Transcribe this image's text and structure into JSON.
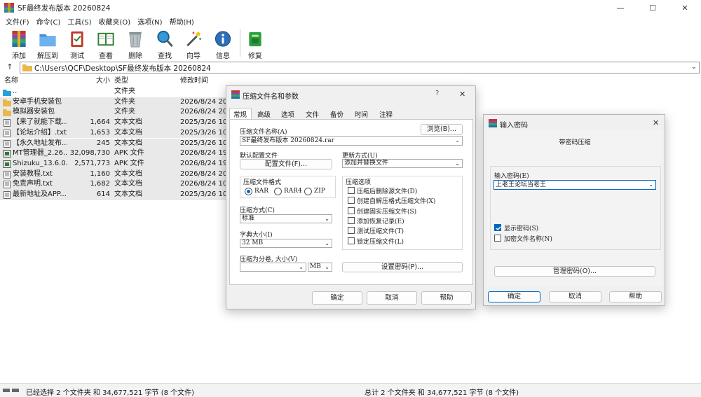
{
  "window": {
    "title": "SF最终发布版本 20260824",
    "minimize": "—",
    "maximize": "☐",
    "close": "✕"
  },
  "menu": [
    "文件(F)",
    "命令(C)",
    "工具(S)",
    "收藏夹(O)",
    "选项(N)",
    "帮助(H)"
  ],
  "toolbar": [
    {
      "label": "添加",
      "icon": "add-archive-icon"
    },
    {
      "label": "解压到",
      "icon": "extract-folder-icon"
    },
    {
      "label": "测试",
      "icon": "test-clipboard-icon"
    },
    {
      "label": "查看",
      "icon": "view-book-icon"
    },
    {
      "label": "删除",
      "icon": "trash-icon"
    },
    {
      "label": "查找",
      "icon": "magnifier-icon"
    },
    {
      "label": "向导",
      "icon": "wizard-wand-icon"
    },
    {
      "label": "信息",
      "icon": "info-icon"
    },
    {
      "label": "修复",
      "icon": "repair-kit-icon"
    }
  ],
  "address": {
    "path": "C:\\Users\\QCF\\Desktop\\SF最终发布版本 20260824",
    "up": "↑",
    "dropdown": "⌄"
  },
  "columns": {
    "name": "名称",
    "size": "大小",
    "type": "类型",
    "modified": "修改时间"
  },
  "files": [
    {
      "name": "..",
      "size": "",
      "type": "文件夹",
      "modified": "",
      "icon": "folder-up-icon",
      "selected": false
    },
    {
      "name": "安卓手机安装包",
      "size": "",
      "type": "文件夹",
      "modified": "2026/8/24 20",
      "icon": "folder-icon",
      "selected": true
    },
    {
      "name": "模拟器安装包",
      "size": "",
      "type": "文件夹",
      "modified": "2026/8/24 20",
      "icon": "folder-icon",
      "selected": true
    },
    {
      "name": "【来了就能下载...",
      "size": "1,664",
      "type": "文本文档",
      "modified": "2025/3/26 10",
      "icon": "text-file-icon",
      "selected": true
    },
    {
      "name": "【论坛介绍】.txt",
      "size": "1,653",
      "type": "文本文档",
      "modified": "2025/3/26 10",
      "icon": "text-file-icon",
      "selected": true
    },
    {
      "name": "【永久地址发布...",
      "size": "245",
      "type": "文本文档",
      "modified": "2025/3/26 10",
      "icon": "text-file-icon",
      "selected": true
    },
    {
      "name": "MT管理器_2.26....",
      "size": "32,098,730",
      "type": "APK 文件",
      "modified": "2026/8/24 19",
      "icon": "apk-file-icon",
      "selected": true
    },
    {
      "name": "Shizuku_13.6.0...",
      "size": "2,571,773",
      "type": "APK 文件",
      "modified": "2026/8/24 19",
      "icon": "apk-file-icon",
      "selected": true
    },
    {
      "name": "安装教程.txt",
      "size": "1,160",
      "type": "文本文档",
      "modified": "2026/8/24 20",
      "icon": "text-file-icon",
      "selected": true
    },
    {
      "name": "免责声明.txt",
      "size": "1,682",
      "type": "文本文档",
      "modified": "2026/8/24 10",
      "icon": "text-file-icon",
      "selected": true
    },
    {
      "name": "最新地址及APP...",
      "size": "614",
      "type": "文本文档",
      "modified": "2025/3/26 10",
      "icon": "text-file-icon",
      "selected": true
    }
  ],
  "status": {
    "left": "已经选择 2 个文件夹 和 34,677,521 字节 (8 个文件)",
    "right": "总计 2 个文件夹 和 34,677,521 字节 (8 个文件)"
  },
  "archive_dialog": {
    "title": "压缩文件名和参数",
    "help_glyph": "?",
    "close_glyph": "✕",
    "tabs": [
      "常规",
      "高级",
      "选项",
      "文件",
      "备份",
      "时间",
      "注释"
    ],
    "archive_name_label": "压缩文件名称(A)",
    "browse_button": "浏览(B)...",
    "archive_name_value": "SF最终发布版本 20260824.rar",
    "default_profile_label": "默认配置文件",
    "profile_button": "配置文件(F)...",
    "update_mode_label": "更新方式(U)",
    "update_mode_value": "添加并替换文件",
    "format_label": "压缩文件格式",
    "formats": [
      "RAR",
      "RAR4",
      "ZIP"
    ],
    "selected_format": "RAR",
    "options_label": "压缩选项",
    "options": [
      {
        "label": "压缩后删除源文件(D)",
        "checked": false
      },
      {
        "label": "创建自解压格式压缩文件(X)",
        "checked": false
      },
      {
        "label": "创建固实压缩文件(S)",
        "checked": false
      },
      {
        "label": "添加恢复记录(E)",
        "checked": false
      },
      {
        "label": "测试压缩文件(T)",
        "checked": false
      },
      {
        "label": "锁定压缩文件(L)",
        "checked": false
      }
    ],
    "method_label": "压缩方式(C)",
    "method_value": "标准",
    "dict_label": "字典大小(I)",
    "dict_value": "32 MB",
    "split_label": "压缩为分卷, 大小(V)",
    "split_value": "",
    "split_unit": "MB",
    "set_password_button": "设置密码(P)...",
    "ok": "确定",
    "cancel": "取消",
    "help": "帮助"
  },
  "password_dialog": {
    "title": "输入密码",
    "close_glyph": "✕",
    "heading": "带密码压缩",
    "enter_label": "输入密码(E)",
    "password_value": "上老王论坛当老王",
    "show_password_label": "显示密码(S)",
    "show_password_checked": true,
    "encrypt_names_label": "加密文件名称(N)",
    "encrypt_names_checked": false,
    "manage_button": "管理密码(O)...",
    "ok": "确定",
    "cancel": "取消",
    "help": "帮助"
  },
  "colors": {
    "accent": "#0067c0",
    "selection": "#e9e9e9",
    "dialog_bg": "#f0f0f0"
  }
}
